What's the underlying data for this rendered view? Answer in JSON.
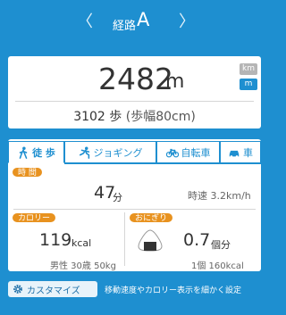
{
  "route": {
    "label": "経路",
    "letter": "A",
    "prev_icon": "chevron-left-icon",
    "next_icon": "chevron-right-icon"
  },
  "summary": {
    "distance_value": "2482",
    "distance_unit": "m",
    "unit_options": [
      "km",
      "m"
    ],
    "selected_unit": "m",
    "steps_value": "3102",
    "steps_unit": "歩",
    "stride": "(歩幅80cm)"
  },
  "tabs": [
    {
      "label": "徒 歩",
      "icon": "walking-icon",
      "active": true
    },
    {
      "label": "ジョギング",
      "icon": "running-icon",
      "active": false
    },
    {
      "label": "自転車",
      "icon": "bicycle-icon",
      "active": false
    },
    {
      "label": "車",
      "icon": "car-icon",
      "active": false
    }
  ],
  "time": {
    "label": "時 間",
    "value": "47",
    "unit": "分",
    "speed": "時速 3.2km/h"
  },
  "calories": {
    "label": "カロリー",
    "value": "119",
    "unit": "kcal",
    "profile": "男性 30歳 50kg"
  },
  "onigiri": {
    "label": "おにぎり",
    "value": "0.7",
    "unit": "個分",
    "per_unit": "1個 160kcal",
    "icon": "onigiri-icon"
  },
  "customize": {
    "button_label": "カスタマイズ",
    "icon": "gear-icon",
    "description": "移動速度やカロリー表示を細かく設定"
  },
  "colors": {
    "background": "#1e8fd0",
    "accent": "#1e8fd0",
    "badge": "#e8921f"
  }
}
